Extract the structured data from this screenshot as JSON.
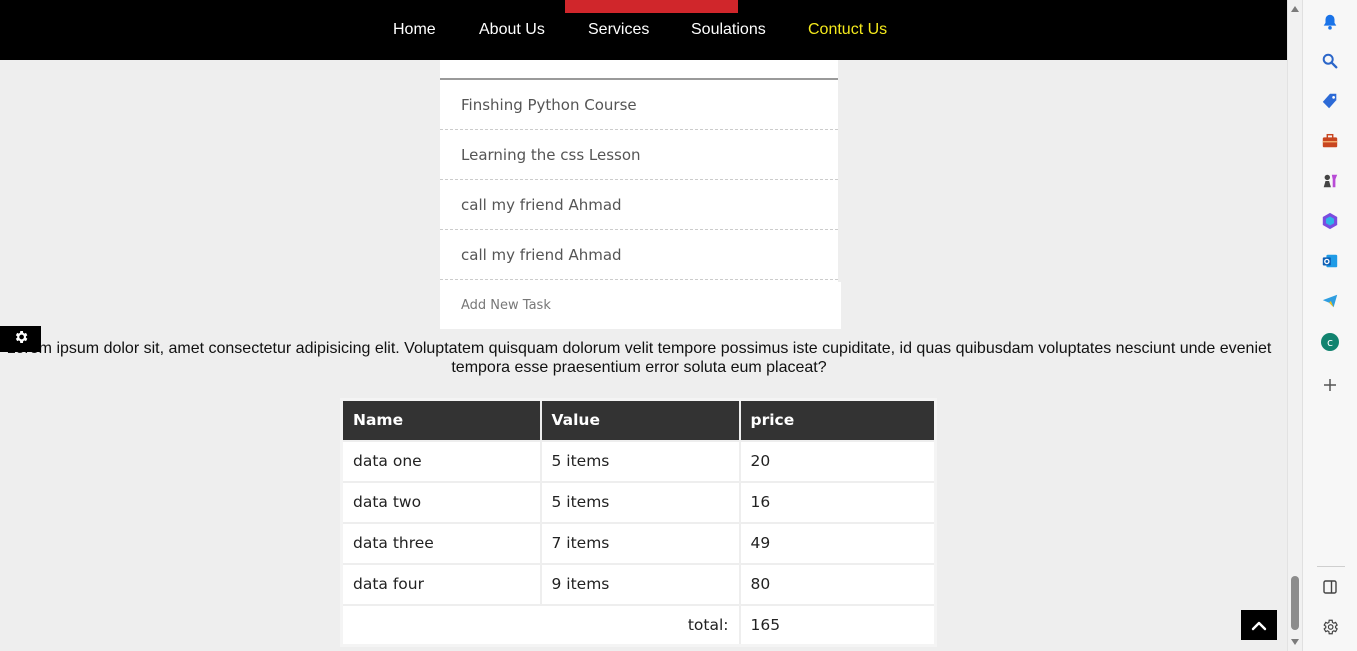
{
  "nav": {
    "links": [
      "Home",
      "About Us",
      "Services",
      "Soulations",
      "Contuct Us"
    ],
    "active_index": 4,
    "accent_color": "#d0262b",
    "active_color": "#f4e91c"
  },
  "tasks": {
    "items": [
      "Finshing Python Course",
      "Learning the css Lesson",
      "call my friend Ahmad",
      "call my friend Ahmad"
    ],
    "add_placeholder": "Add New Task"
  },
  "paragraph": "Lorem ipsum dolor sit, amet consectetur adipisicing elit. Voluptatem quisquam dolorum velit tempore possimus iste cupiditate, id quas quibusdam voluptates nesciunt unde eveniet tempora esse praesentium error soluta eum placeat?",
  "table": {
    "headers": [
      "Name",
      "Value",
      "price"
    ],
    "rows": [
      [
        "data one",
        "5 items",
        "20"
      ],
      [
        "data two",
        "5 items",
        "16"
      ],
      [
        "data three",
        "7 items",
        "49"
      ],
      [
        "data four",
        "9 items",
        "80"
      ]
    ],
    "total_label": "total:",
    "total_value": "165"
  },
  "sidebar_icons": [
    "bell-icon",
    "search-icon",
    "tag-icon",
    "toolbox-icon",
    "chess-icon",
    "office-icon",
    "outlook-icon",
    "telegram-icon",
    "c-app-icon",
    "plus-icon",
    "split-screen-icon",
    "settings-icon"
  ],
  "icons": {
    "gear": "gear-icon",
    "back_to_top": "chevron-up-icon"
  }
}
